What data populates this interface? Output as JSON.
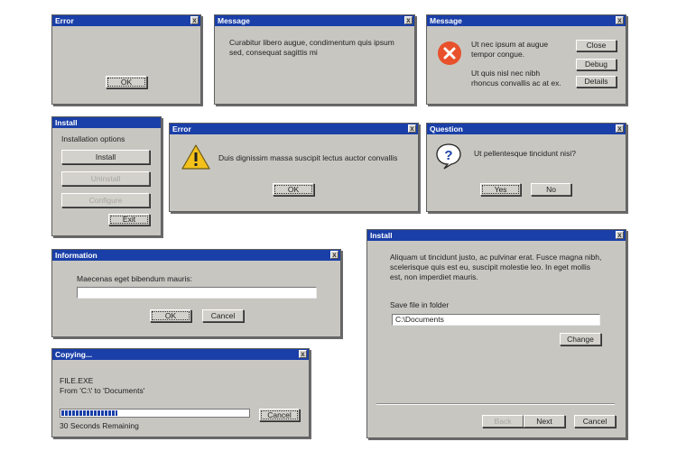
{
  "close_glyph": "x",
  "colors": {
    "titlebar": "#1a3fa8",
    "window": "#c8c6c1",
    "progress": "#1a3fa8"
  },
  "w1": {
    "title": "Error",
    "ok": "OK"
  },
  "w2": {
    "title": "Message",
    "text": "Curabitur libero augue, condimentum quis ipsum sed, consequat sagittis mi"
  },
  "w3": {
    "title": "Message",
    "icon": "error-x-icon",
    "text1": "Ut nec ipsum at augue tempor congue.",
    "text2": "Ut quis nisl nec nibh rhoncus convallis ac at ex.",
    "buttons": [
      "Close",
      "Debug",
      "Details"
    ]
  },
  "w4": {
    "title": "Install",
    "heading": "Installation options",
    "buttons": [
      "Install",
      "Uninstall",
      "Configure",
      "Exit"
    ]
  },
  "w5": {
    "title": "Error",
    "icon": "warning-icon",
    "text": "Duis dignissim massa suscipit lectus auctor convallis",
    "ok": "OK"
  },
  "w6": {
    "title": "Question",
    "icon": "question-icon",
    "text": "Ut pellentesque tincidunt nisi?",
    "yes": "Yes",
    "no": "No"
  },
  "w7": {
    "title": "Information",
    "label": "Maecenas eget bibendum mauris:",
    "value": "",
    "ok": "OK",
    "cancel": "Cancel"
  },
  "w8": {
    "title": "Install",
    "text": "Aliquam ut tincidunt justo, ac pulvinar erat. Fusce magna nibh, scelerisque quis est eu, suscipit molestie leo. In eget mollis est, non imperdiet mauris.",
    "folder_label": "Save file in folder",
    "folder_value": "C:\\Documents",
    "change": "Change",
    "back": "Back",
    "next": "Next",
    "cancel": "Cancel"
  },
  "w9": {
    "title": "Copying...",
    "file": "FILE.EXE",
    "from": "From 'C:\\' to 'Documents'",
    "progress": 0.3,
    "remaining": "30 Seconds Remaining",
    "cancel": "Cancel"
  }
}
